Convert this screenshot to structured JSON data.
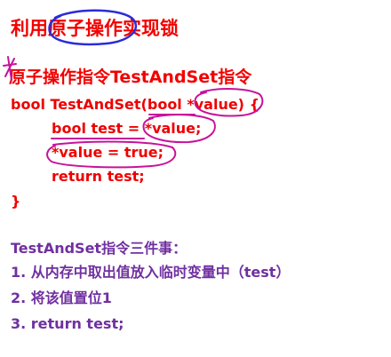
{
  "colors": {
    "accent_red": "#f20000",
    "code_red": "#ee0000",
    "body_purple": "#7030a0",
    "blue_ink": "#2b2bd9",
    "magenta_ink": "#c8129a"
  },
  "title": "利用原子操作实现锁",
  "section_heading": "原子操作指令TestAndSet指令",
  "code_lines": [
    "bool TestAndSet(bool *value) {",
    "bool test = *value;",
    "*value = true;",
    "return test;",
    "}"
  ],
  "steps_heading": "TestAndSet指令三件事：",
  "steps": [
    "1. 从内存中取出值放入临时变量中（test）",
    "2. 将该值置位1",
    "3. return test;"
  ]
}
